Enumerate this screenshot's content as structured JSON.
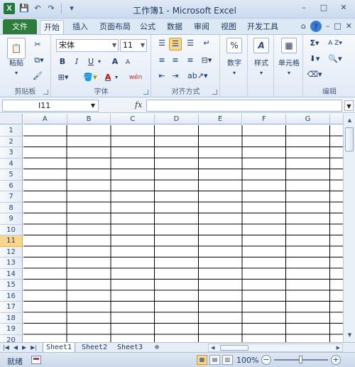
{
  "titlebar": {
    "title": "工作簿1 - Microsoft Excel",
    "logo_letter": "X",
    "qat": [
      "save-icon",
      "undo-icon",
      "redo-icon",
      "customize-icon"
    ],
    "window_buttons": [
      "–",
      "□",
      "✕"
    ]
  },
  "tabs": {
    "file": "文件",
    "items": [
      "开始",
      "插入",
      "页面布局",
      "公式",
      "数据",
      "审阅",
      "视图",
      "开发工具"
    ],
    "active": "开始",
    "right_controls": [
      "⌂",
      "?",
      "–",
      "□",
      "✕"
    ]
  },
  "ribbon": {
    "clipboard": {
      "label": "剪贴板",
      "paste": "粘贴"
    },
    "font": {
      "label": "字体",
      "font_name": "宋体",
      "font_size": "11",
      "bold": "B",
      "italic": "I",
      "underline": "U",
      "grow": "A",
      "shrink": "A",
      "color_letter": "A",
      "wen": "wén"
    },
    "alignment": {
      "label": "对齐方式"
    },
    "number": {
      "label": "数字",
      "button": "数字",
      "glyph": "%"
    },
    "styles": {
      "button": "样式",
      "glyph": "A"
    },
    "cells": {
      "button": "单元格"
    },
    "editing": {
      "label": "编辑",
      "sum": "Σ",
      "sort": "A Z",
      "find": "🔍"
    }
  },
  "formula_bar": {
    "name_box": "I11",
    "fx": "fx",
    "formula": ""
  },
  "grid": {
    "columns": [
      "A",
      "B",
      "C",
      "D",
      "E",
      "F",
      "G"
    ],
    "rows": [
      "1",
      "2",
      "3",
      "4",
      "5",
      "6",
      "7",
      "8",
      "9",
      "10",
      "11",
      "12",
      "13",
      "14",
      "15",
      "16",
      "17",
      "18",
      "19",
      "20"
    ],
    "selected_row": "11"
  },
  "sheets": {
    "tabs": [
      "Sheet1",
      "Sheet2",
      "Sheet3"
    ],
    "active": "Sheet1"
  },
  "status": {
    "text": "就绪",
    "zoom": "100%",
    "zoom_level": 0.5
  },
  "colors": {
    "accent_file_tab": "#2d7d3a",
    "selected_header": "#f8d78a"
  }
}
